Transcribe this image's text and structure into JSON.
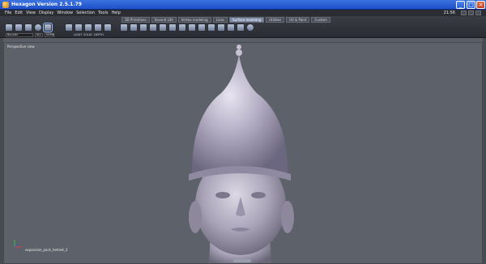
{
  "window": {
    "title": "Hexagon Version 2.5.1.79",
    "controls": [
      "_",
      "□",
      "×"
    ]
  },
  "menubar": {
    "items": [
      "File",
      "Edit",
      "View",
      "Display",
      "Window",
      "Selection",
      "Tools",
      "Help"
    ],
    "clock": "21:56"
  },
  "toolbar": {
    "tabs": [
      {
        "label": "3D Primitives"
      },
      {
        "label": "Second Life"
      },
      {
        "label": "Vertex modeling"
      },
      {
        "label": "Lines"
      },
      {
        "label": "Surface modeling"
      },
      {
        "label": "Utilities"
      },
      {
        "label": "UV & Paint"
      },
      {
        "label": "Custom"
      }
    ],
    "active_tab": "Surface modeling",
    "left_field": "Bounds",
    "left_buttons": [
      "ALL",
      "NONE"
    ],
    "group_labels": [
      "LIGHT",
      "SOLID",
      "DEPTH"
    ]
  },
  "viewport": {
    "label": "Perspective view",
    "object_label": "expansion_pack_helmet_2"
  },
  "colors": {
    "titlebar": "#1c50c9",
    "viewport_bg": "#5d6169",
    "model_tint": "#b8b2c8"
  }
}
